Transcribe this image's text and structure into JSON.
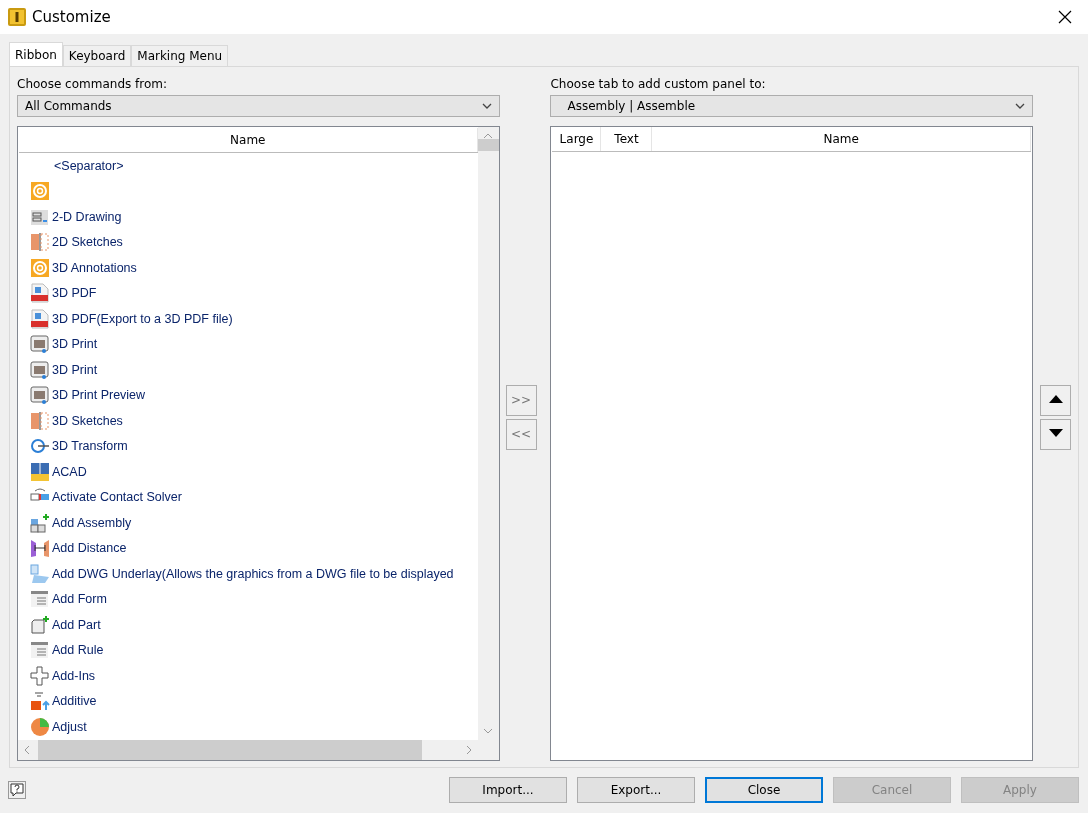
{
  "window": {
    "title": "Customize"
  },
  "tabs": [
    {
      "label": "Ribbon",
      "selected": true
    },
    {
      "label": "Keyboard",
      "selected": false
    },
    {
      "label": "Marking Menu",
      "selected": false
    }
  ],
  "commands": {
    "label": "Choose commands from:",
    "value": "All Commands",
    "columns": [
      "Name"
    ],
    "rows": [
      {
        "kind": "none",
        "label": "<Separator>"
      },
      {
        "kind": "at",
        "label": ""
      },
      {
        "kind": "drawing",
        "label": "2-D Drawing"
      },
      {
        "kind": "sketch",
        "label": "2D Sketches"
      },
      {
        "kind": "at",
        "label": "3D Annotations"
      },
      {
        "kind": "pdf",
        "label": "3D PDF"
      },
      {
        "kind": "pdf",
        "label": "3D PDF(Export to a 3D PDF file)"
      },
      {
        "kind": "print",
        "label": "3D Print"
      },
      {
        "kind": "print",
        "label": "3D Print"
      },
      {
        "kind": "print",
        "label": "3D Print Preview"
      },
      {
        "kind": "sketch",
        "label": "3D Sketches"
      },
      {
        "kind": "transform",
        "label": "3D Transform"
      },
      {
        "kind": "grid",
        "label": "ACAD"
      },
      {
        "kind": "solver",
        "label": "Activate Contact Solver"
      },
      {
        "kind": "assembly",
        "label": "Add Assembly"
      },
      {
        "kind": "distance",
        "label": "Add Distance"
      },
      {
        "kind": "underlay",
        "label": "Add DWG Underlay(Allows the graphics from a DWG file to be displayed"
      },
      {
        "kind": "form",
        "label": "Add Form"
      },
      {
        "kind": "part",
        "label": "Add Part"
      },
      {
        "kind": "form",
        "label": "Add Rule"
      },
      {
        "kind": "plus",
        "label": "Add-Ins"
      },
      {
        "kind": "additive",
        "label": "Additive"
      },
      {
        "kind": "pie",
        "label": "Adjust"
      }
    ]
  },
  "move_buttons": [
    ">>",
    "<<"
  ],
  "target": {
    "label": "Choose tab to add custom panel to:",
    "value": "Assembly | Assemble",
    "columns": [
      "Large",
      "Text",
      "Name"
    ]
  },
  "buttons": [
    {
      "label": "Import...",
      "disabled": false,
      "selected": false
    },
    {
      "label": "Export...",
      "disabled": false,
      "selected": false
    },
    {
      "label": "Close",
      "disabled": false,
      "selected": true
    },
    {
      "label": "Cancel",
      "disabled": true,
      "selected": false
    },
    {
      "label": "Apply",
      "disabled": true,
      "selected": false
    }
  ]
}
